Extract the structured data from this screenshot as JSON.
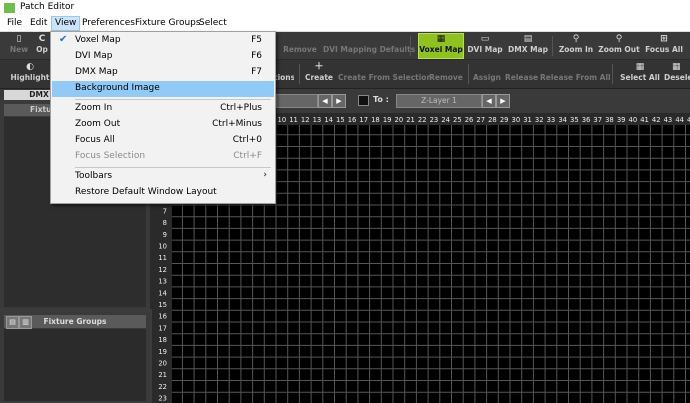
{
  "window": {
    "title": "Patch Editor"
  },
  "menubar": [
    "File",
    "Edit",
    "View",
    "Preferences",
    "Fixture Groups",
    "Select"
  ],
  "toolbar1": {
    "partial_left": [
      "New",
      "Op"
    ],
    "right": [
      {
        "label": "Remove",
        "icon": "remove-icon",
        "dim": true
      },
      {
        "label": "DVI Mapping Defaults",
        "icon": "",
        "dim": true
      },
      {
        "label": "Voxel Map",
        "icon": "voxel-icon",
        "active": true
      },
      {
        "label": "DVI Map",
        "icon": "dvi-icon"
      },
      {
        "label": "DMX Map",
        "icon": "dmx-icon"
      },
      {
        "label": "Zoom In",
        "icon": "zoom-in-icon"
      },
      {
        "label": "Zoom Out",
        "icon": "zoom-out-icon"
      },
      {
        "label": "Focus All",
        "icon": "focus-icon"
      }
    ]
  },
  "toolbar2": {
    "partial_left": [
      "Highlight"
    ],
    "right": [
      {
        "label": "tions"
      },
      {
        "label": "Create"
      },
      {
        "label": "Create From Selection",
        "dim": true
      },
      {
        "label": "Remove",
        "dim": true
      },
      {
        "label": "Assign",
        "dim": true
      },
      {
        "label": "Release",
        "dim": true
      },
      {
        "label": "Release From All",
        "dim": true
      },
      {
        "label": "Select All"
      },
      {
        "label": "Desele"
      }
    ]
  },
  "left_panel": {
    "tab": "DMX",
    "fixtures_header": "Fixtur"
  },
  "groups_panel": {
    "header": "Fixture Groups"
  },
  "layer_bar": {
    "to_label": "To :",
    "to_layer": "Z-Layer 1"
  },
  "grid": {
    "columns": [
      "10",
      "11",
      "12",
      "13",
      "14",
      "15",
      "16",
      "17",
      "18",
      "19",
      "20",
      "21",
      "22",
      "23",
      "24",
      "25",
      "26",
      "27",
      "28",
      "29",
      "30",
      "31",
      "32",
      "33",
      "34",
      "35",
      "36",
      "37",
      "38",
      "39",
      "40",
      "41",
      "42",
      "43",
      "44",
      "45",
      "46"
    ],
    "rows": [
      "7",
      "8",
      "9",
      "10",
      "11",
      "12",
      "13",
      "14",
      "15",
      "16",
      "17",
      "18",
      "19",
      "20",
      "21",
      "22",
      "23"
    ]
  },
  "view_menu": {
    "items": [
      {
        "label": "Voxel Map",
        "shortcut": "F5",
        "checked": true
      },
      {
        "label": "DVI Map",
        "shortcut": "F6"
      },
      {
        "label": "DMX Map",
        "shortcut": "F7"
      },
      {
        "label": "Background Image",
        "shortcut": "",
        "highlighted": true
      },
      {
        "separator": true
      },
      {
        "label": "Zoom In",
        "shortcut": "Ctrl+Plus"
      },
      {
        "label": "Zoom Out",
        "shortcut": "Ctrl+Minus"
      },
      {
        "label": "Focus All",
        "shortcut": "Ctrl+0"
      },
      {
        "label": "Focus Selection",
        "shortcut": "Ctrl+F",
        "disabled": true
      },
      {
        "separator": true
      },
      {
        "label": "Toolbars",
        "shortcut": "",
        "submenu": true
      },
      {
        "label": "Restore Default Window Layout",
        "shortcut": ""
      }
    ]
  },
  "colors": {
    "active_green": "#8dc21f",
    "menu_highlight": "#91c9f7",
    "grid_line": "#555555"
  }
}
